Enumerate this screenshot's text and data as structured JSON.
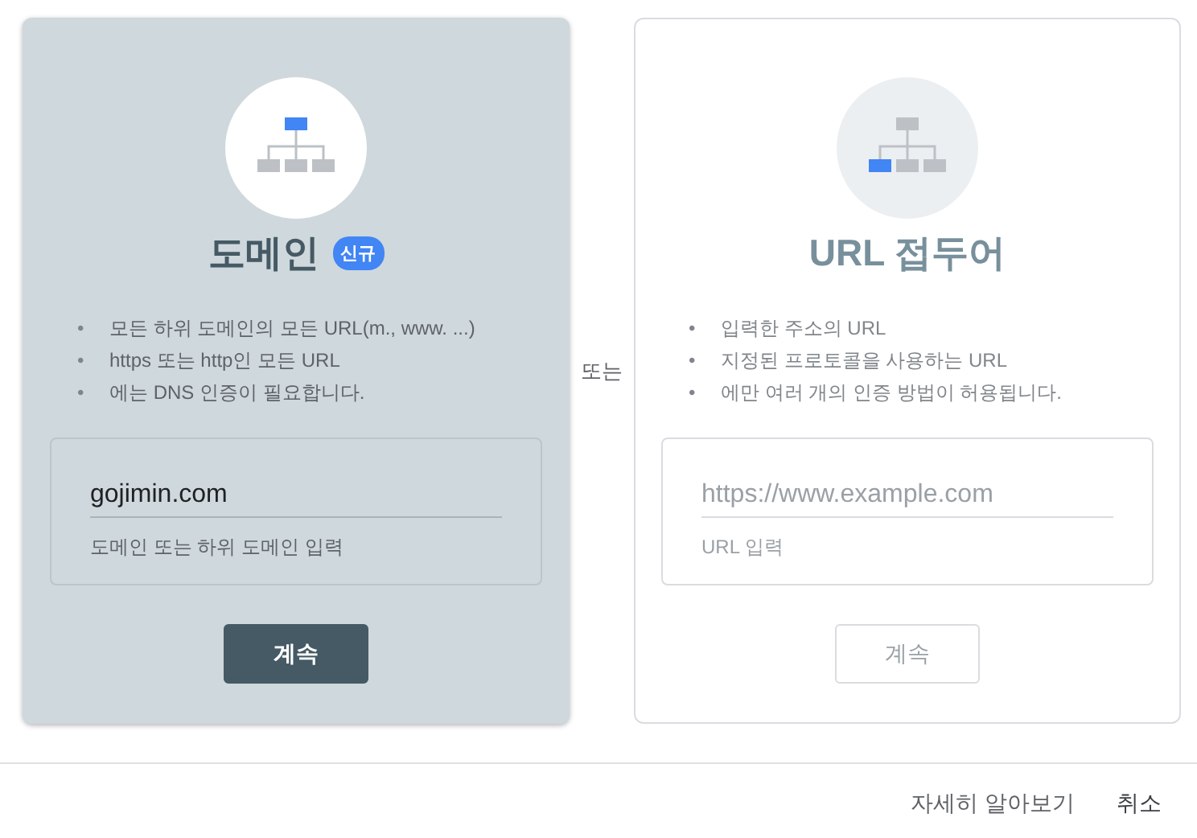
{
  "cards": [
    {
      "kind": "domain",
      "selected": true,
      "title": "도메인",
      "badge": "신규",
      "bullets": [
        {
          "marker": "•",
          "text": "모든 하위 도메인의 모든 URL(m., www. ...)"
        },
        {
          "marker": "•",
          "text": "https 또는 http인 모든 URL"
        },
        {
          "marker": "•",
          "text": "에는 DNS 인증이 필요합니다."
        }
      ],
      "input": {
        "value": "gojimin.com"
      },
      "helper": "도메인 또는 하위 도메인 입력",
      "button": {
        "label": "계속",
        "disabled": false
      }
    },
    {
      "kind": "prefix",
      "selected": false,
      "title": "URL 접두어",
      "bullets": [
        {
          "marker": "•",
          "text": "입력한 주소의 URL"
        },
        {
          "marker": "•",
          "text": "지정된 프로토콜을 사용하는 URL"
        },
        {
          "marker": "•",
          "text": "에만 여러 개의 인증 방법이 허용됩니다."
        }
      ],
      "input": {
        "placeholder": "https://www.example.com"
      },
      "helper": "URL 입력",
      "button": {
        "label": "계속",
        "disabled": true
      }
    }
  ],
  "separator": "또는",
  "footer": {
    "buttons": [
      "자세히 알아보기",
      "취소"
    ]
  }
}
